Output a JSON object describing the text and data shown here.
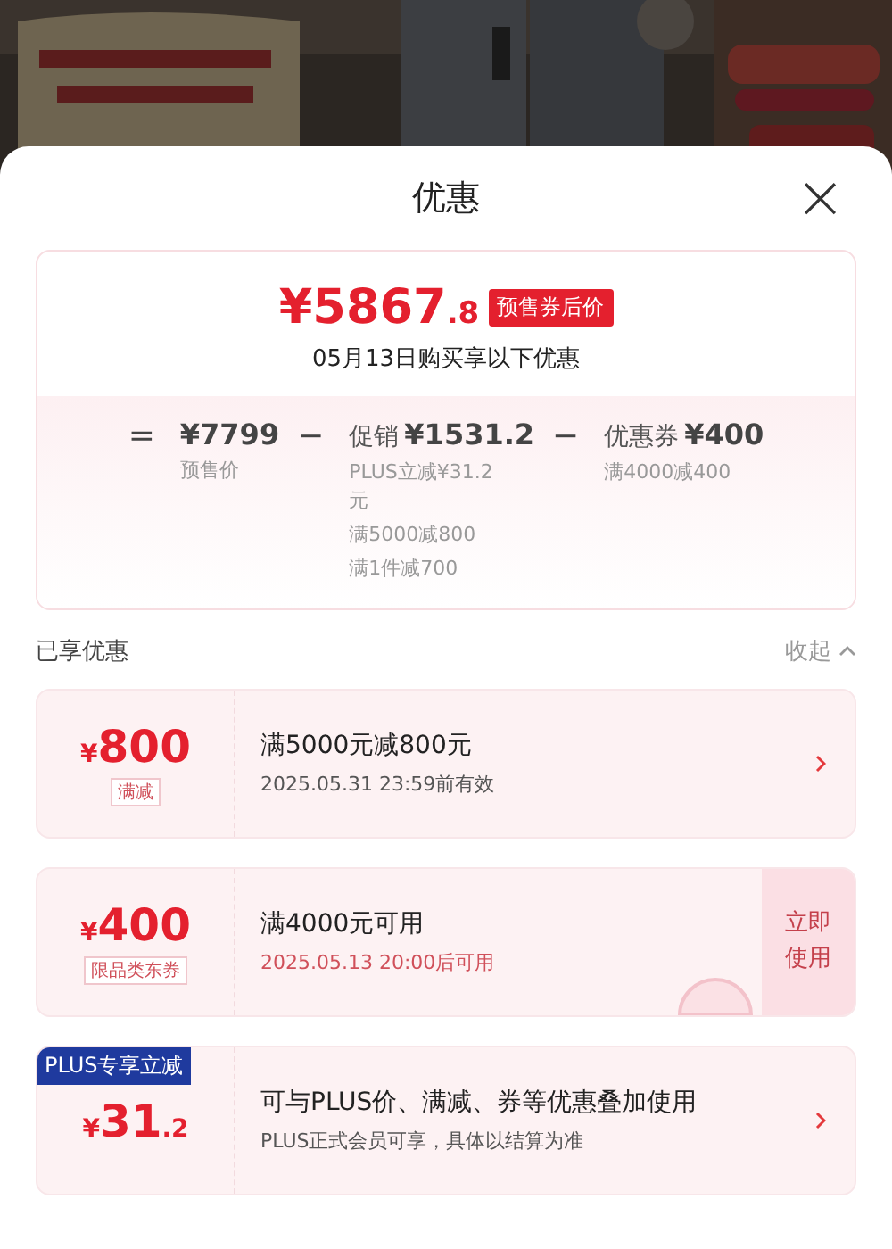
{
  "sheet": {
    "title": "优惠",
    "close": "×"
  },
  "summary": {
    "currency": "¥",
    "price": "5867",
    "price_decimal": ".8",
    "price_tag": "预售券后价",
    "date_line": "05月13日购买享以下优惠",
    "breakdown": [
      {
        "op": "=",
        "amount": "¥7799",
        "notes": [
          "预售价"
        ]
      },
      {
        "op": "−",
        "name": "促销",
        "amount": "¥1531.2",
        "notes": [
          "PLUS立减¥31.2元",
          "满5000减800",
          "满1件减700"
        ]
      },
      {
        "op": "−",
        "name": "优惠券",
        "amount": "¥400",
        "notes": [
          "满4000减400"
        ]
      }
    ]
  },
  "section": {
    "title": "已享优惠",
    "toggle": "收起",
    "expanded": true
  },
  "coupons": [
    {
      "kind": "arrow",
      "currency": "¥",
      "amount": "800",
      "tag": "满减",
      "title": "满5000元减800元",
      "subtitle": "2025.05.31 23:59前有效",
      "subtitle_highlight": false,
      "stamped": false
    },
    {
      "kind": "button",
      "currency": "¥",
      "amount": "400",
      "tag": "限品类东券",
      "title": "满4000元可用",
      "subtitle": "2025.05.13 20:00后可用",
      "subtitle_highlight": true,
      "action": "立即使用",
      "stamped": true
    },
    {
      "kind": "arrow",
      "currency": "¥",
      "amount": "31",
      "amount_decimal": ".2",
      "ribbon": "PLUS专享立减",
      "title": "可与PLUS价、满减、券等优惠叠加使用",
      "subtitle": "PLUS正式会员可享，具体以结算为准",
      "subtitle_highlight": false,
      "stamped": false
    }
  ]
}
